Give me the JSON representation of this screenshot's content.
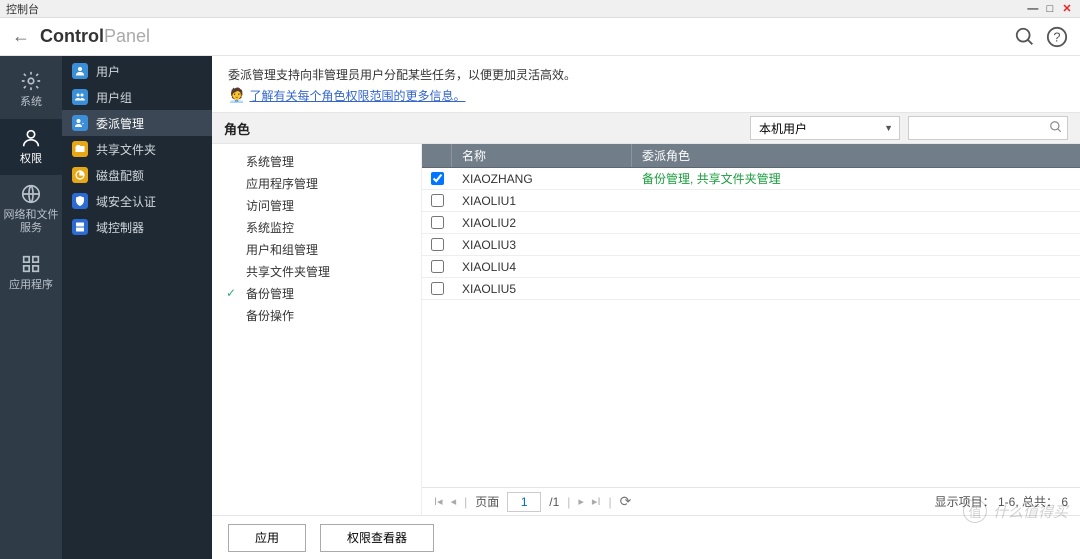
{
  "os_title": "控制台",
  "app_title_strong": "Control",
  "app_title_light": "Panel",
  "rail": [
    {
      "id": "system",
      "label": "系统"
    },
    {
      "id": "privilege",
      "label": "权限"
    },
    {
      "id": "network",
      "label": "网络和文件\n服务"
    },
    {
      "id": "apps",
      "label": "应用程序"
    }
  ],
  "rail_active": 1,
  "nav2": [
    {
      "id": "users",
      "label": "用户",
      "color": "#3a8fd8"
    },
    {
      "id": "usergroups",
      "label": "用户组",
      "color": "#3a8fd8"
    },
    {
      "id": "delegation",
      "label": "委派管理",
      "color": "#3a8fd8"
    },
    {
      "id": "shared",
      "label": "共享文件夹",
      "color": "#e6a817"
    },
    {
      "id": "quota",
      "label": "磁盘配额",
      "color": "#e6a817"
    },
    {
      "id": "domainsec",
      "label": "域安全认证",
      "color": "#2c6bd4"
    },
    {
      "id": "domaincontroller",
      "label": "域控制器",
      "color": "#2c6bd4"
    }
  ],
  "nav2_active": 2,
  "desc": "委派管理支持向非管理员用户分配某些任务，以便更加灵活高效。",
  "link_label": "了解有关每个角色权限范围的更多信息。",
  "section_title": "角色",
  "filter_select": "本机用户",
  "search_placeholder": "",
  "roles": [
    {
      "label": "系统管理",
      "selected": false
    },
    {
      "label": "应用程序管理",
      "selected": false
    },
    {
      "label": "访问管理",
      "selected": false
    },
    {
      "label": "系统监控",
      "selected": false
    },
    {
      "label": "用户和组管理",
      "selected": false
    },
    {
      "label": "共享文件夹管理",
      "selected": false
    },
    {
      "label": "备份管理",
      "selected": true
    },
    {
      "label": "备份操作",
      "selected": false
    }
  ],
  "table": {
    "col_name": "名称",
    "col_role": "委派角色",
    "rows": [
      {
        "checked": true,
        "name": "XIAOZHANG",
        "role": "备份管理, 共享文件夹管理"
      },
      {
        "checked": false,
        "name": "XIAOLIU1",
        "role": ""
      },
      {
        "checked": false,
        "name": "XIAOLIU2",
        "role": ""
      },
      {
        "checked": false,
        "name": "XIAOLIU3",
        "role": ""
      },
      {
        "checked": false,
        "name": "XIAOLIU4",
        "role": ""
      },
      {
        "checked": false,
        "name": "XIAOLIU5",
        "role": ""
      }
    ]
  },
  "pager": {
    "label_page": "页面",
    "current": "1",
    "total": "/1",
    "status": "显示项目：  1-6, 总共：  6"
  },
  "footer": {
    "apply": "应用",
    "viewer": "权限查看器"
  },
  "watermark": "什么值得买"
}
